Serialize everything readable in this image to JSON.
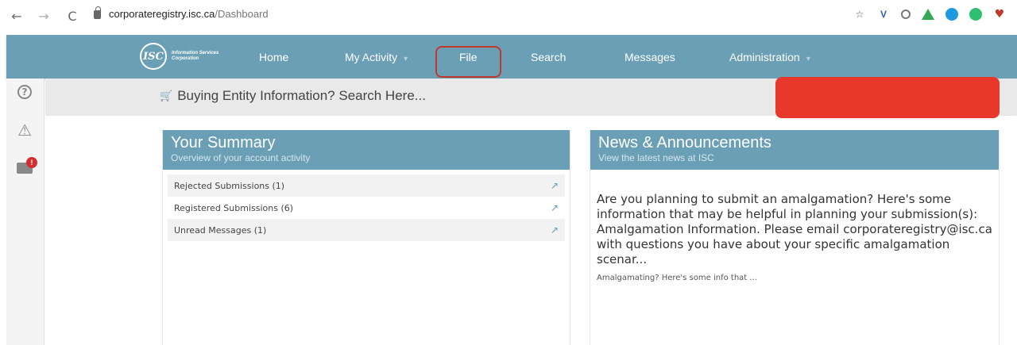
{
  "browser": {
    "host": "corporateregistry.isc.ca",
    "path": "/Dashboard",
    "back_icon": "←",
    "forward_icon": "→",
    "reload_icon": "C",
    "star_icon": "☆"
  },
  "app": {
    "logo_mark": "ISC",
    "logo_text": "Information Services Corporation",
    "nav": {
      "home": "Home",
      "my_activity": "My Activity",
      "file": "File",
      "search": "Search",
      "messages": "Messages",
      "administration": "Administration"
    },
    "caret": "▾",
    "highlight_color": "#c0392b",
    "accent_color": "#6b9fb5"
  },
  "rail": {
    "help": "?",
    "warning": "⚠",
    "mail_badge": "!"
  },
  "search": {
    "cart_icon": "🛒",
    "text": "Buying Entity Information? Search Here..."
  },
  "summary": {
    "title": "Your Summary",
    "subtitle": "Overview of your account activity",
    "rows": [
      {
        "label": "Rejected Submissions (1)",
        "link": "↗"
      },
      {
        "label": "Registered Submissions (6)",
        "link": "↗"
      },
      {
        "label": "Unread Messages (1)",
        "link": "↗"
      }
    ]
  },
  "news": {
    "title": "News & Announcements",
    "subtitle": "View the latest news at ISC",
    "body": "Are you planning to submit an amalgamation? Here's some information that may be helpful in planning your submission(s): Amalgamation Information. Please email corporateregistry@isc.ca with questions you have about your specific amalgamation scenar...",
    "link_text": "Amalgamating? Here's some info that ..."
  }
}
